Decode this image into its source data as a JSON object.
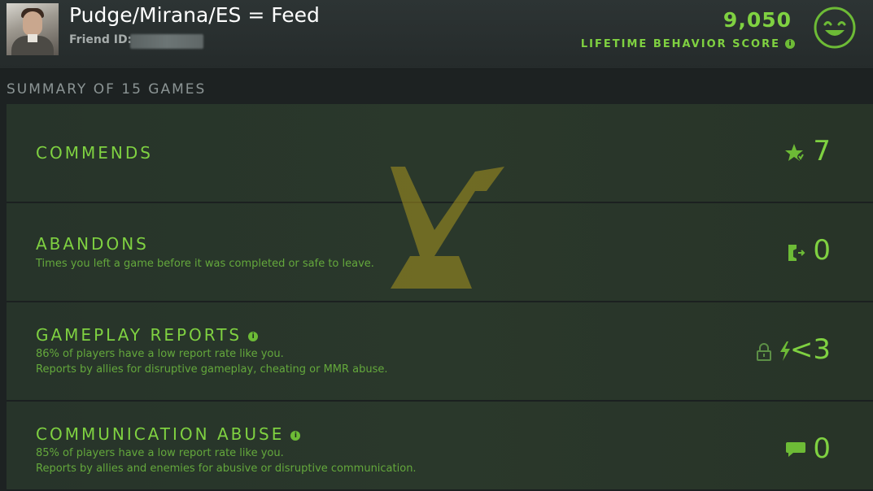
{
  "header": {
    "player_name": "Pudge/Mirana/ES = Feed",
    "friend_id_label": "Friend ID:",
    "score_value": "9,050",
    "score_label": "LIFETIME BEHAVIOR SCORE",
    "info_glyph": "i",
    "icons": {
      "score_info": "info-icon",
      "smiley": "smiley-face-icon"
    }
  },
  "summary": {
    "title": "SUMMARY OF 15 GAMES"
  },
  "panels": [
    {
      "title": "COMMENDS",
      "value": "7",
      "icon": "commend-star-icon"
    },
    {
      "title": "ABANDONS",
      "description": "Times you left a game before it was completed or safe to leave.",
      "value": "0",
      "icon": "door-exit-icon"
    },
    {
      "title": "GAMEPLAY REPORTS",
      "line1": "86% of players have a low report rate like you.",
      "line2": "Reports by allies for disruptive gameplay, cheating or MMR abuse.",
      "value": "<3",
      "icons": [
        "lock-icon",
        "lightning-icon"
      ],
      "has_info": true
    },
    {
      "title": "COMMUNICATION ABUSE",
      "line1": "85% of players have a low report rate like you.",
      "line2": "Reports by allies and enemies for abusive or disruptive communication.",
      "value": "0",
      "icon": "speech-bubble-icon",
      "has_info": true
    }
  ],
  "colors": {
    "accent_green": "#7fd141",
    "desc_green": "#64a83c",
    "emblem_gold": "#a8951f"
  }
}
